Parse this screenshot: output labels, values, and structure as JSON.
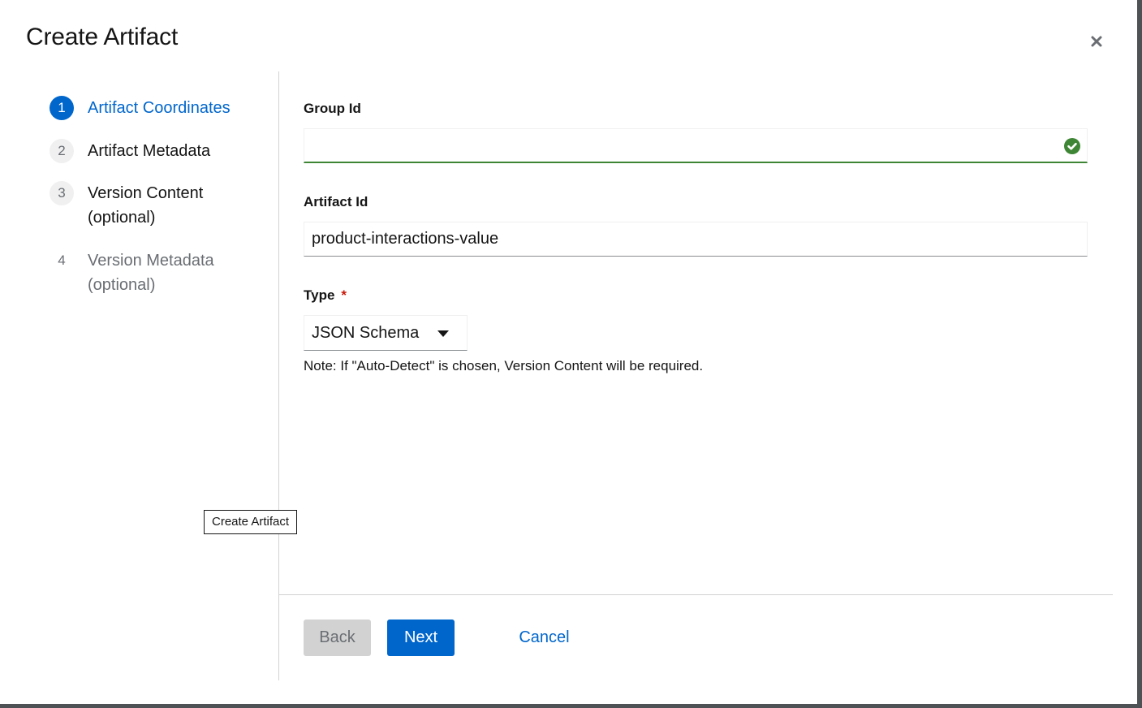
{
  "modal": {
    "title": "Create Artifact",
    "close_label": "×"
  },
  "wizard": {
    "steps": [
      {
        "number": "1",
        "label": "Artifact Coordinates",
        "state": "current"
      },
      {
        "number": "2",
        "label": "Artifact Metadata",
        "state": "enabled"
      },
      {
        "number": "3",
        "label": "Version Content (optional)",
        "state": "enabled"
      },
      {
        "number": "4",
        "label": "Version Metadata (optional)",
        "state": "disabled"
      }
    ]
  },
  "form": {
    "group_id": {
      "label": "Group Id",
      "value": "",
      "status": "success"
    },
    "artifact_id": {
      "label": "Artifact Id",
      "value": "product-interactions-value"
    },
    "type": {
      "label": "Type",
      "required_marker": "*",
      "selected": "JSON Schema",
      "note": "Note: If \"Auto-Detect\" is chosen, Version Content will be required."
    }
  },
  "tooltip": {
    "text": "Create Artifact"
  },
  "footer": {
    "back_label": "Back",
    "next_label": "Next",
    "cancel_label": "Cancel"
  },
  "colors": {
    "primary": "#0066cc",
    "success": "#3e8635",
    "danger": "#c9190b",
    "disabled_bg": "#d2d2d2"
  }
}
